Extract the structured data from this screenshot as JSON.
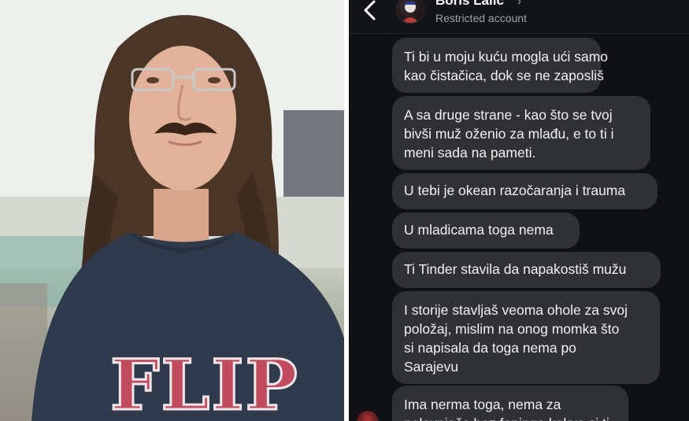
{
  "header": {
    "contact_name": "Boris Lalić",
    "chevron": "›",
    "status": "Restricted account",
    "back_icon": "chevron-left-icon"
  },
  "photo": {
    "shirt_text": "FLIP"
  },
  "messages": [
    {
      "lines": [
        "Ti bi u moju kuću mogla ući samo",
        "kao čistačica, dok se ne zaposliš"
      ]
    },
    {
      "lines": [
        "A sa druge strane - kao što se tvoj",
        "bivši muž oženio za mlađu, e to ti i",
        "meni sada na pameti."
      ]
    },
    {
      "lines": [
        "U tebi je okean razočaranja i trauma"
      ]
    },
    {
      "lines": [
        "U mladicama toga nema"
      ]
    },
    {
      "lines": [
        "Ti Tinder stavila da napakostiš mužu"
      ]
    },
    {
      "lines": [
        "I storije stavljaš veoma ohole za svoj",
        "položaj, mislim na onog momka što",
        "si napisala da toga nema po",
        "Sarajevu"
      ]
    },
    {
      "lines": [
        "Ima nerma toga, nema za",
        "polovnjače bez fepinga kakva si ti"
      ]
    }
  ],
  "colors": {
    "chat_background": "#0f1115",
    "bubble": "#303135",
    "shirt": "#2f3a4c",
    "shirt_print": "#c04a5e"
  }
}
